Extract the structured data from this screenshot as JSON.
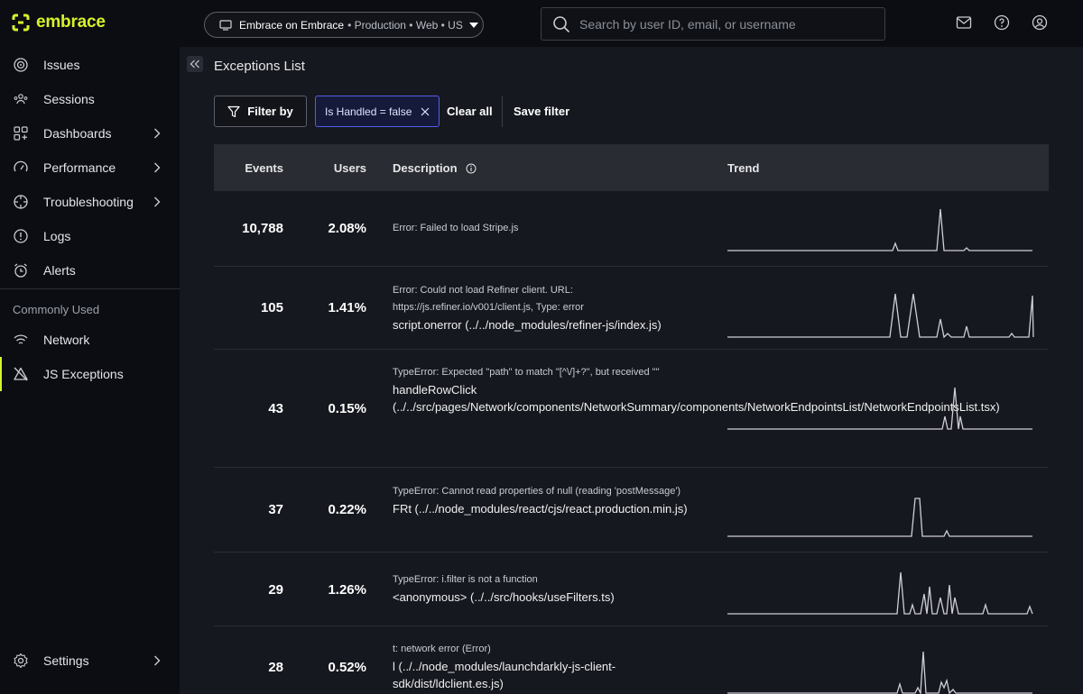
{
  "brand": {
    "name": "embrace",
    "accent": "#d8f22a"
  },
  "env_selector": {
    "app": "Embrace on Embrace",
    "meta": "• Production • Web • US"
  },
  "search": {
    "placeholder": "Search by user ID, email, or username"
  },
  "top_icons": [
    "inbox-icon",
    "help-icon",
    "user-icon"
  ],
  "sidebar": {
    "items": [
      {
        "label": "Issues",
        "icon": "target-icon",
        "chevron": false
      },
      {
        "label": "Sessions",
        "icon": "users-icon",
        "chevron": false
      },
      {
        "label": "Dashboards",
        "icon": "dashboard-icon",
        "chevron": true
      },
      {
        "label": "Performance",
        "icon": "gauge-icon",
        "chevron": true
      },
      {
        "label": "Troubleshooting",
        "icon": "crosshair-icon",
        "chevron": true
      },
      {
        "label": "Logs",
        "icon": "alert-circle-icon",
        "chevron": false
      },
      {
        "label": "Alerts",
        "icon": "alarm-icon",
        "chevron": false
      }
    ],
    "section_title": "Commonly Used",
    "common": [
      {
        "label": "Network",
        "icon": "wifi-icon"
      },
      {
        "label": "JS Exceptions",
        "icon": "alert-triangle-off-icon",
        "active": true
      }
    ],
    "settings": {
      "label": "Settings",
      "icon": "gear-icon"
    }
  },
  "page": {
    "title": "Exceptions List",
    "filter_label": "Filter by",
    "active_filter": "Is Handled = false",
    "clear_all": "Clear all",
    "save_filter": "Save filter"
  },
  "table": {
    "headers": {
      "events": "Events",
      "users": "Users",
      "description": "Description",
      "trend": "Trend"
    },
    "rows": [
      {
        "events": "10,788",
        "users": "2.08%",
        "error": "Error: Failed to load Stripe.js",
        "location": ""
      },
      {
        "events": "105",
        "users": "1.41%",
        "error": "Error: Could not load Refiner client. URL: https://js.refiner.io/v001/client.js, Type: error",
        "location": "script.onerror (../../node_modules/refiner-js/index.js)"
      },
      {
        "events": "43",
        "users": "0.15%",
        "error": "TypeError: Expected \"path\" to match \"[^\\/]+?\", but received \"\"",
        "location": "handleRowClick (../../src/pages/Network/components/NetworkSummary/components/NetworkEndpointsList/NetworkEndpointsList.tsx)"
      },
      {
        "events": "37",
        "users": "0.22%",
        "error": "TypeError: Cannot read properties of null (reading 'postMessage')",
        "location": "FRt (../../node_modules/react/cjs/react.production.min.js)"
      },
      {
        "events": "29",
        "users": "1.26%",
        "error": "TypeError: i.filter is not a function",
        "location": "<anonymous> (../../src/hooks/useFilters.ts)"
      },
      {
        "events": "28",
        "users": "0.52%",
        "error": "t: network error (Error)",
        "location": "l (../../node_modules/launchdarkly-js-client-sdk/dist/ldclient.es.js)"
      }
    ]
  }
}
